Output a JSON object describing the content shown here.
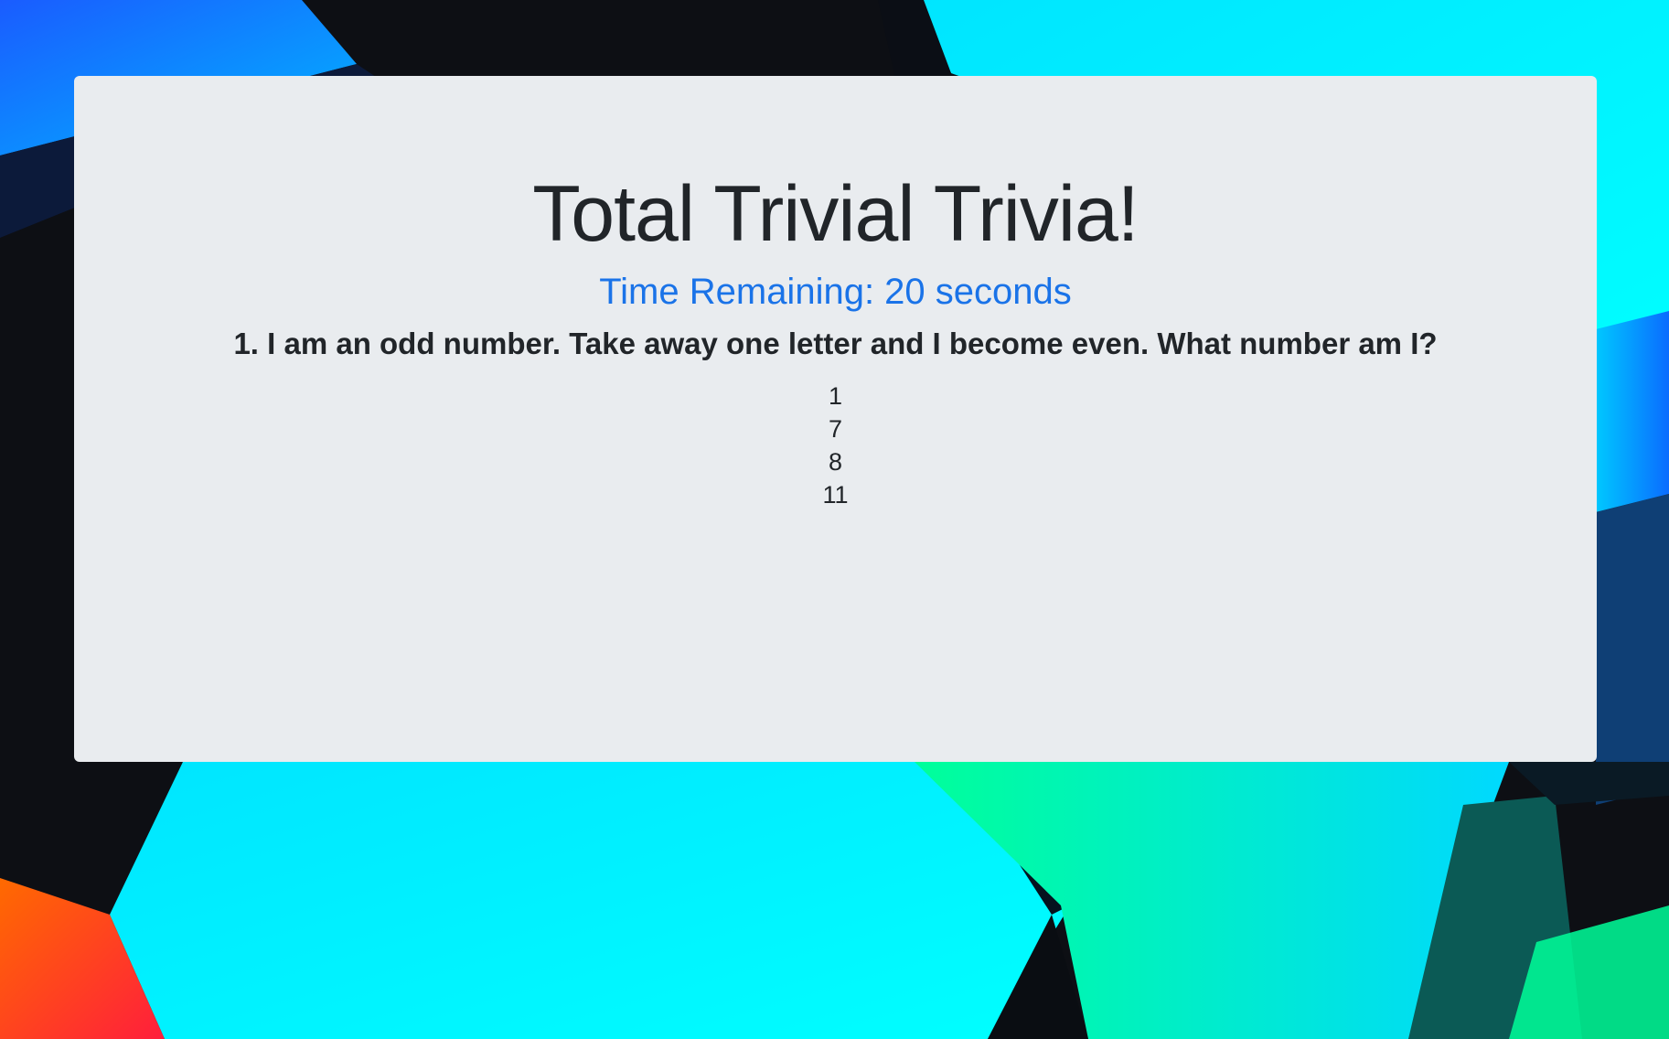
{
  "page": {
    "title": "Total Trivial Trivia!",
    "timer_text": "Time Remaining: 20 seconds",
    "question": "1. I am an odd number. Take away one letter and I become even. What number am I?",
    "answers": [
      "1",
      "7",
      "8",
      "11"
    ]
  },
  "colors": {
    "panel": "#e9ecef",
    "timer": "#1a73e8",
    "text": "#212529"
  }
}
